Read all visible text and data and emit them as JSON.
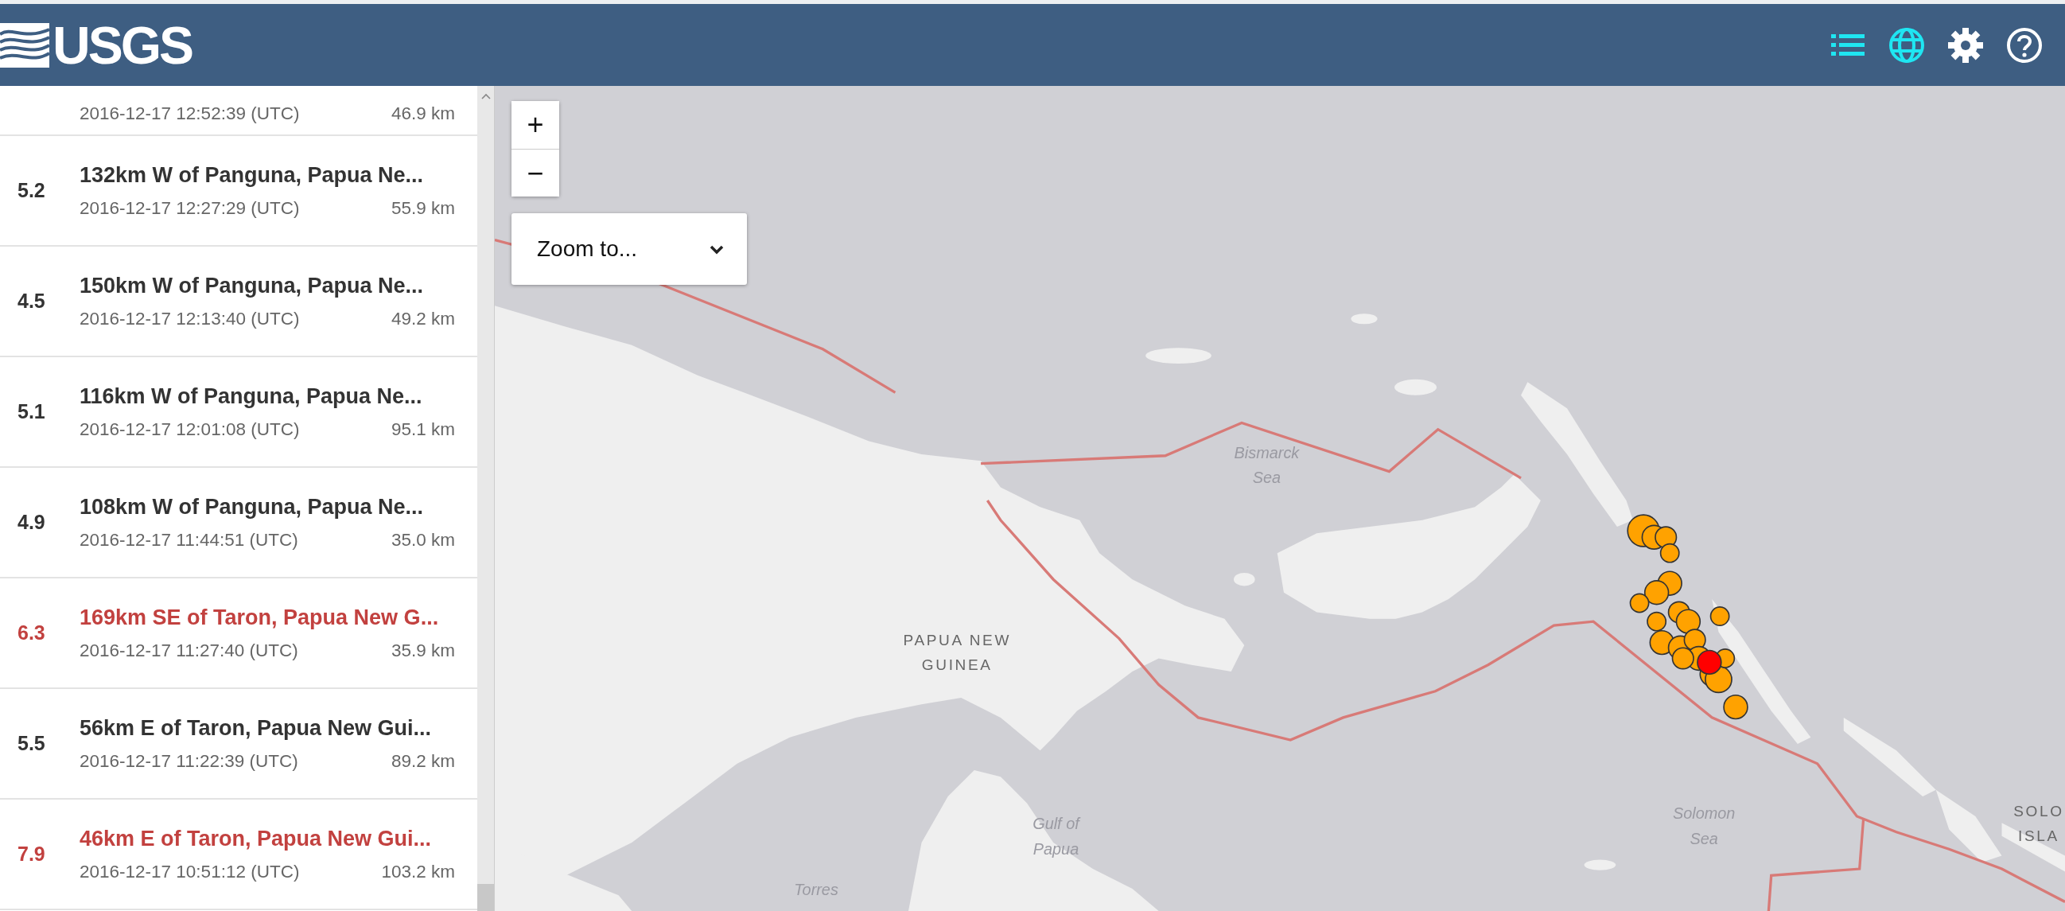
{
  "header": {
    "logo": "USGS",
    "tools": [
      {
        "kind": "list",
        "on": true
      },
      {
        "kind": "globe",
        "on": true
      },
      {
        "kind": "settings",
        "on": false
      },
      {
        "kind": "help",
        "on": false
      }
    ]
  },
  "events": [
    {
      "time": "2016-12-17 12:52:39 (UTC)",
      "depth": "46.9 km"
    },
    {
      "magnitude": "5.2",
      "title": "132km W of Panguna, Papua Ne...",
      "time": "2016-12-17 12:27:29 (UTC)",
      "depth": "55.9 km",
      "alert": false
    },
    {
      "magnitude": "4.5",
      "title": "150km W of Panguna, Papua Ne...",
      "time": "2016-12-17 12:13:40 (UTC)",
      "depth": "49.2 km",
      "alert": false
    },
    {
      "magnitude": "5.1",
      "title": "116km W of Panguna, Papua Ne...",
      "time": "2016-12-17 12:01:08 (UTC)",
      "depth": "95.1 km",
      "alert": false
    },
    {
      "magnitude": "4.9",
      "title": "108km W of Panguna, Papua Ne...",
      "time": "2016-12-17 11:44:51 (UTC)",
      "depth": "35.0 km",
      "alert": false
    },
    {
      "magnitude": "6.3",
      "title": "169km SE of Taron, Papua New G...",
      "time": "2016-12-17 11:27:40 (UTC)",
      "depth": "35.9 km",
      "alert": true
    },
    {
      "magnitude": "5.5",
      "title": "56km E of Taron, Papua New Gui...",
      "time": "2016-12-17 11:22:39 (UTC)",
      "depth": "89.2 km",
      "alert": false
    },
    {
      "magnitude": "7.9",
      "title": "46km E of Taron, Papua New Gui...",
      "time": "2016-12-17 10:51:12 (UTC)",
      "depth": "103.2 km",
      "alert": true
    }
  ],
  "map": {
    "zoom_in": "+",
    "zoom_out": "−",
    "zoom_to": {
      "label": "Zoom to..."
    },
    "labels": [
      {
        "kind": "sea",
        "lines": [
          "Bismarck",
          "Sea"
        ]
      },
      {
        "kind": "country",
        "lines": [
          "PAPUA NEW",
          "GUINEA"
        ]
      },
      {
        "kind": "sea",
        "lines": [
          "Gulf of",
          "Papua"
        ]
      },
      {
        "kind": "sea",
        "lines": [
          "Torres"
        ]
      },
      {
        "kind": "sea",
        "lines": [
          "Solomon",
          "Sea"
        ]
      },
      {
        "kind": "country",
        "lines": [
          "SOLO",
          "ISLA"
        ]
      }
    ]
  }
}
